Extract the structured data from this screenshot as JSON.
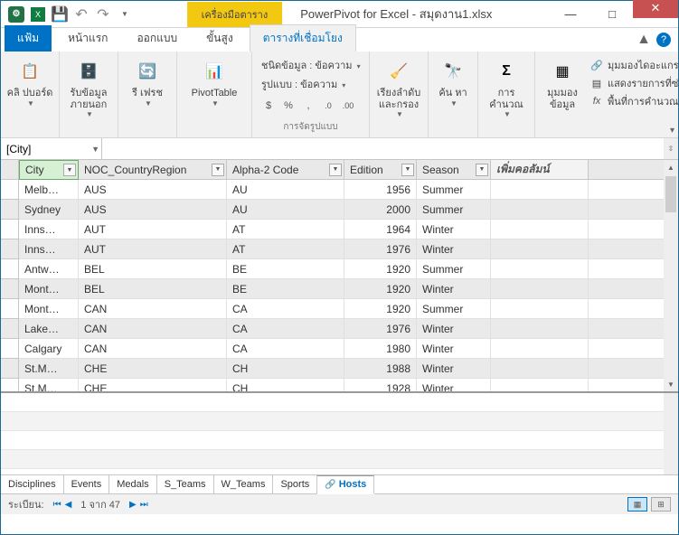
{
  "window": {
    "contextual_tab": "เครื่องมือตาราง",
    "title": "PowerPivot for Excel - สมุดงาน1.xlsx",
    "minimize": "—",
    "maximize": "□",
    "close": "✕"
  },
  "tabs": {
    "file": "แฟ้ม",
    "home": "หน้าแรก",
    "design": "ออกแบบ",
    "advanced": "ขั้นสูง",
    "linked": "ตารางที่เชื่อมโยง"
  },
  "ribbon": {
    "clipboard": {
      "paste": "คลิ\nปบอร์ด",
      "group": ""
    },
    "external": {
      "get": "รับข้อมูล\nภายนอก"
    },
    "refresh": {
      "label": "รี\nเฟรช"
    },
    "pivot": {
      "label": "PivotTable"
    },
    "formatting": {
      "datatype": "ชนิดข้อมูล : ข้อความ",
      "format": "รูปแบบ : ข้อความ",
      "currency": "$",
      "percent": "%",
      "comma": ",",
      "dec_inc": ".0←",
      "dec_dec": ".00→",
      "group": "การจัดรูปแบบ"
    },
    "sortfilter": {
      "label": "เรียงลำดับ\nและกรอง"
    },
    "find": {
      "label": "ค้น\nหา"
    },
    "calc": {
      "label": "การ\nคำนวณ"
    },
    "view": {
      "label": "มุมมอง\nข้อมูล"
    },
    "view_list": {
      "diagram": "มุมมองไดอะแกรม",
      "hidden": "แสดงรายการที่ซ่อนอยู่",
      "calc_area": "พื้นที่การคำนวณ"
    }
  },
  "namebox": "[City]",
  "columns": {
    "city": "City",
    "noc": "NOC_CountryRegion",
    "alpha2": "Alpha-2 Code",
    "edition": "Edition",
    "season": "Season",
    "add": "เพิ่มคอลัมน์"
  },
  "rows": [
    {
      "city": "Melb…",
      "noc": "AUS",
      "a2": "AU",
      "ed": "1956",
      "se": "Summer"
    },
    {
      "city": "Sydney",
      "noc": "AUS",
      "a2": "AU",
      "ed": "2000",
      "se": "Summer"
    },
    {
      "city": "Inns…",
      "noc": "AUT",
      "a2": "AT",
      "ed": "1964",
      "se": "Winter"
    },
    {
      "city": "Inns…",
      "noc": "AUT",
      "a2": "AT",
      "ed": "1976",
      "se": "Winter"
    },
    {
      "city": "Antw…",
      "noc": "BEL",
      "a2": "BE",
      "ed": "1920",
      "se": "Summer"
    },
    {
      "city": "Mont…",
      "noc": "BEL",
      "a2": "BE",
      "ed": "1920",
      "se": "Winter"
    },
    {
      "city": "Mont…",
      "noc": "CAN",
      "a2": "CA",
      "ed": "1920",
      "se": "Summer"
    },
    {
      "city": "Lake…",
      "noc": "CAN",
      "a2": "CA",
      "ed": "1976",
      "se": "Winter"
    },
    {
      "city": "Calgary",
      "noc": "CAN",
      "a2": "CA",
      "ed": "1980",
      "se": "Winter"
    },
    {
      "city": "St.M…",
      "noc": "CHE",
      "a2": "CH",
      "ed": "1988",
      "se": "Winter"
    },
    {
      "city": "St.M…",
      "noc": "CHE",
      "a2": "CH",
      "ed": "1928",
      "se": "Winter"
    }
  ],
  "sheets": {
    "disciplines": "Disciplines",
    "events": "Events",
    "medals": "Medals",
    "s_teams": "S_Teams",
    "w_teams": "W_Teams",
    "sports": "Sports",
    "hosts": "Hosts"
  },
  "status": {
    "record_label": "ระเบียน:",
    "position": "1 จาก 47"
  }
}
